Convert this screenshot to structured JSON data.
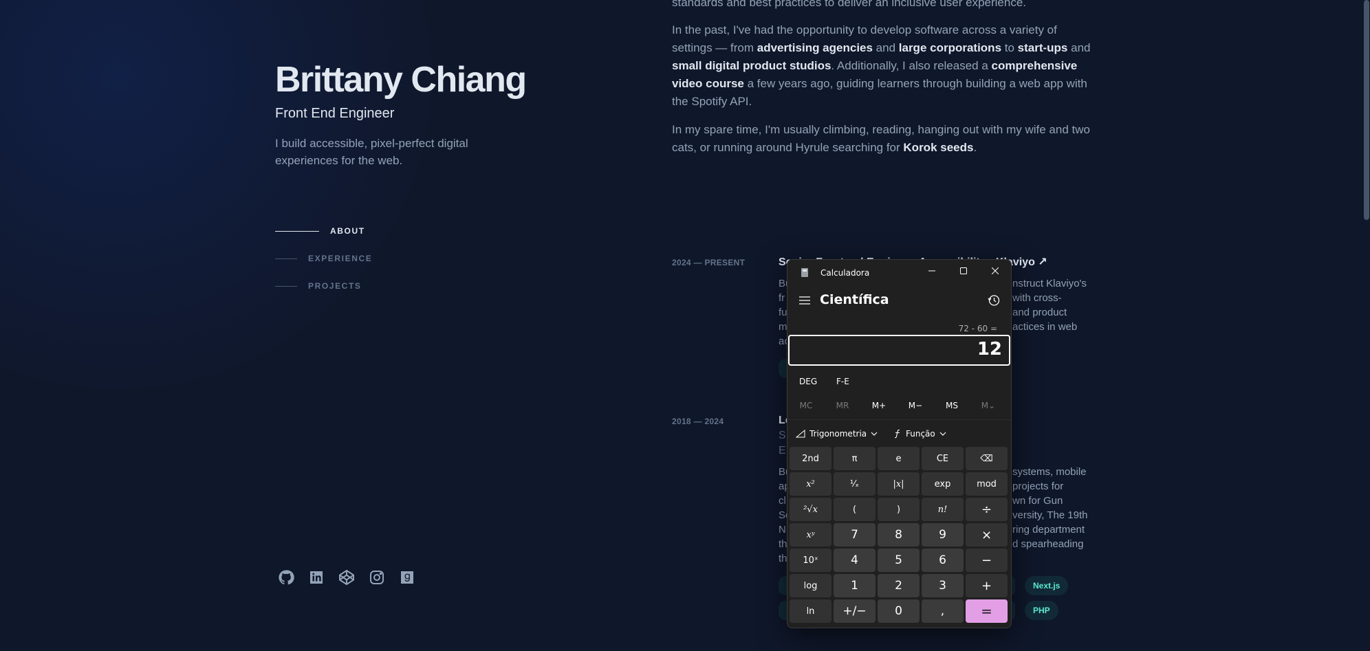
{
  "profile": {
    "name": "Brittany Chiang",
    "role": "Front End Engineer",
    "tagline": "I build accessible, pixel-perfect digital experiences for the web."
  },
  "nav": [
    {
      "label": "ABOUT",
      "active": true
    },
    {
      "label": "EXPERIENCE",
      "active": false
    },
    {
      "label": "PROJECTS",
      "active": false
    }
  ],
  "socials": [
    "github-icon",
    "linkedin-icon",
    "codepen-icon",
    "instagram-icon",
    "goodreads-icon"
  ],
  "about": {
    "p0": "standards and best practices to deliver an inclusive user experience.",
    "p1": {
      "t1": "In the past, I've had the opportunity to develop software across a variety of settings — from ",
      "b1": "advertising agencies",
      "t2": " and ",
      "b2": "large corporations",
      "t3": " to ",
      "b3": "start-ups",
      "t4": " and ",
      "b4": "small digital product studios",
      "t5": ". Additionally, I also released a ",
      "b5": "comprehensive video course",
      "t6": " a few years ago, guiding learners through building a web app with the Spotify API."
    },
    "p2": {
      "t1": "In my spare time, I'm usually climbing, reading, hanging out with my wife and two cats, or running around Hyrule searching for ",
      "b1": "Korok seeds",
      "t2": "."
    }
  },
  "experience": [
    {
      "date": "2024 — PRESENT",
      "title": "Senior Frontend Engineer, Accessibility · Klaviyo ↗",
      "body_lines": [
        "Bu",
        "fr",
        "fu",
        "m",
        "ac"
      ],
      "body_right": [
        "nstruct Klaviyo's",
        "with cross-",
        "and product",
        "actices in web"
      ]
    },
    {
      "date": "2018 — 2024",
      "title_partial": "Le",
      "sub_lines": [
        "S",
        "E"
      ],
      "body_lines": [
        "Bu",
        "ap",
        "cl",
        "Sc",
        "N",
        "th",
        "th"
      ],
      "body_right": [
        "systems, mobile",
        "projects for",
        "wn for Gun",
        "versity, The 19th",
        "ring department",
        "d spearheading"
      ],
      "tags": [
        "Next.js",
        "PHP"
      ]
    }
  ],
  "calculator": {
    "app_title": "Calculadora",
    "mode": "Científica",
    "expression": "72 - 60 =",
    "result": "12",
    "toggles": [
      "DEG",
      "F-E"
    ],
    "memory": [
      "MC",
      "MR",
      "M+",
      "M−",
      "MS",
      "M⌄"
    ],
    "trig_label": "Trigonometria",
    "func_label": "Função",
    "keys": [
      "2nd",
      "π",
      "e",
      "CE",
      "⌫",
      "x²",
      "¹⁄ₓ",
      "|x|",
      "exp",
      "mod",
      "²√x",
      "(",
      ")",
      "n!",
      "÷",
      "xʸ",
      "7",
      "8",
      "9",
      "×",
      "10ˣ",
      "4",
      "5",
      "6",
      "−",
      "log",
      "1",
      "2",
      "3",
      "+",
      "ln",
      "+/−",
      "0",
      ",",
      "="
    ],
    "colors": {
      "equals": "#e39fe6",
      "window": "#202020"
    }
  }
}
